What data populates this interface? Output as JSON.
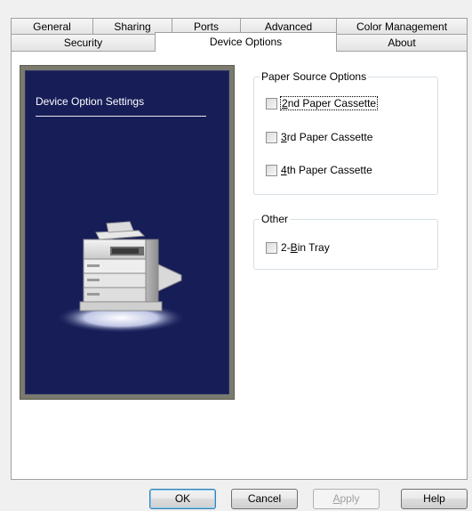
{
  "tabs_row_back": [
    {
      "label": "General",
      "name": "tab-general"
    },
    {
      "label": "Sharing",
      "name": "tab-sharing"
    },
    {
      "label": "Ports",
      "name": "tab-ports"
    },
    {
      "label": "Advanced",
      "name": "tab-advanced"
    },
    {
      "label": "Color Management",
      "name": "tab-color-management"
    }
  ],
  "tabs_row_front": [
    {
      "label": "Security",
      "name": "tab-security"
    },
    {
      "label": "Device Options",
      "name": "tab-device-options",
      "active": true
    },
    {
      "label": "About",
      "name": "tab-about"
    }
  ],
  "preview": {
    "title": "Device Option Settings",
    "icon": "printer-icon"
  },
  "paper_source": {
    "legend": "Paper Source Options",
    "options": [
      {
        "label_mnemonic": "2",
        "label_rest": "nd Paper Cassette",
        "checked": false,
        "focused": true
      },
      {
        "label_mnemonic": "3",
        "label_rest": "rd Paper Cassette",
        "checked": false
      },
      {
        "label_mnemonic": "4",
        "label_rest": "th Paper Cassette",
        "checked": false
      }
    ]
  },
  "other": {
    "legend": "Other",
    "options": [
      {
        "label_pre": "2-",
        "label_mnemonic": "B",
        "label_rest": "in Tray",
        "checked": false
      }
    ]
  },
  "buttons": {
    "ok": "OK",
    "cancel": "Cancel",
    "apply_mnemonic": "A",
    "apply_rest": "pply",
    "help": "Help"
  },
  "colors": {
    "preview_background": "#161d57",
    "preview_frame": "#7a7a6e",
    "default_button_border": "#3c7fb1"
  }
}
